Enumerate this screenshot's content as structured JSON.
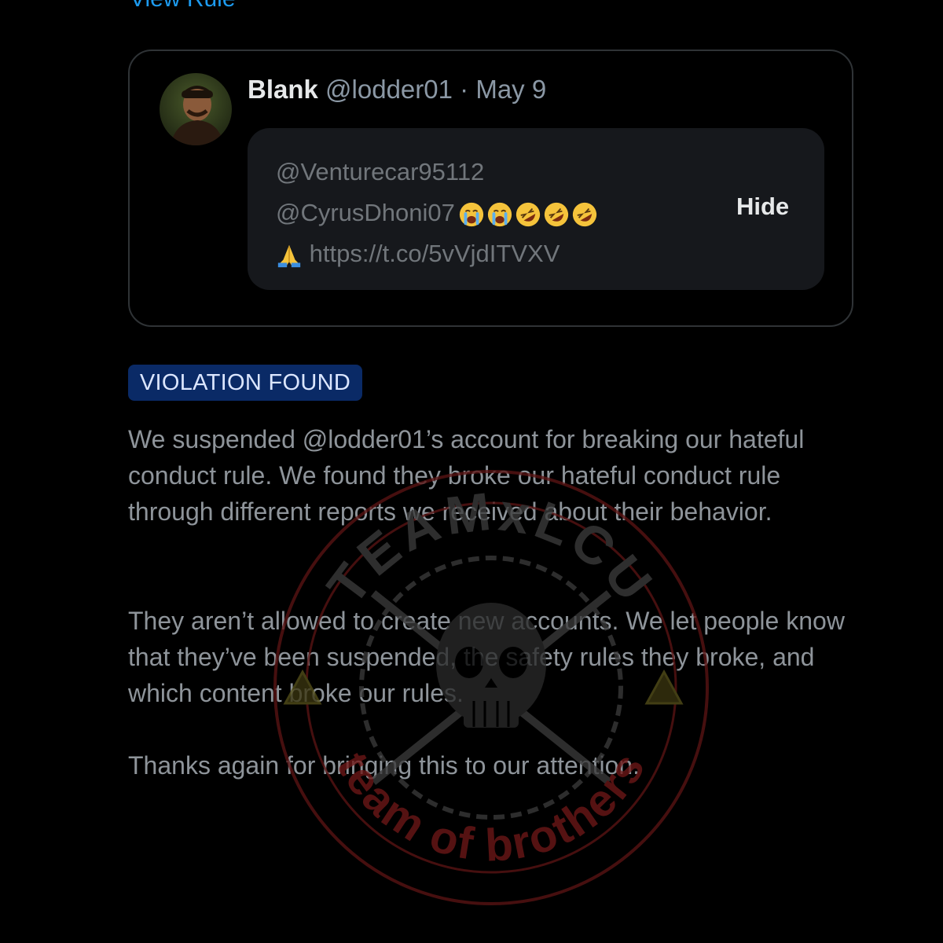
{
  "top_link": "View Rule",
  "tweet": {
    "author_name": "Blank",
    "author_handle": "@lodder01",
    "separator": "·",
    "date": "May 9",
    "hidden_reply": {
      "line1": "@Venturecar95112",
      "line2": "@CyrusDhoni07",
      "line2_emojis": [
        "loudly-crying-face",
        "loudly-crying-face",
        "rolling-on-floor-laughing",
        "rolling-on-floor-laughing",
        "rolling-on-floor-laughing"
      ],
      "line3_emoji": "folded-hands",
      "line3_link": "https://t.co/5vVjdITVXV",
      "hide_label": "Hide"
    }
  },
  "violation": {
    "badge": "VIOLATION FOUND",
    "paragraph1": "We suspended @lodder01’s account for breaking our hateful conduct rule. We found they broke our hateful conduct rule through different reports we received about their behavior.",
    "paragraph2": "They aren’t allowed to create new accounts. We let people know that they’ve been suspended, the safety rules they broke, and which content broke our rules.",
    "paragraph3": "Thanks again for bringing this to our attention."
  },
  "watermark": {
    "top_text": "TEAMxLCU",
    "bottom_text": "team of brothers",
    "color": "#7a1a1a"
  },
  "colors": {
    "accent_link": "#1d9bf0",
    "badge_bg": "#0a2a66",
    "background": "#000000"
  }
}
